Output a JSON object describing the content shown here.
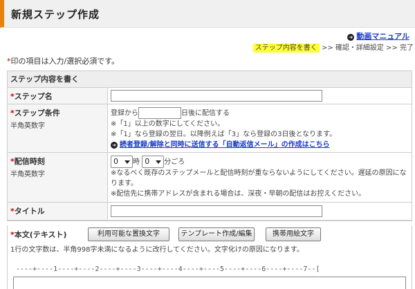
{
  "header": {
    "title": "新規ステップ作成"
  },
  "manual_link": {
    "icon": "circle-arrow-icon",
    "label": "動画マニュアル"
  },
  "steps": {
    "current": "ステップ内容を書く",
    "rest": " >> 確認・詳細設定 >> 完了"
  },
  "required_note": {
    "mark": "*",
    "text": "印の項目は入力/選択必須です。"
  },
  "section": {
    "title": "ステップ内容を書く"
  },
  "fields": {
    "step_name": {
      "mark": "*",
      "label": "ステップ名",
      "value": ""
    },
    "condition": {
      "mark": "*",
      "label": "ステップ条件",
      "sub": "半角英数字",
      "prefix": "登録から",
      "value": "",
      "suffix": "日後に配信する",
      "note1": "※「1」以上の数字にしてください。",
      "note2": "※「1」なら登録の翌日。以降例えば「3」なら登録の3日後となります。",
      "link_icon": "circle-arrow-icon",
      "link": "読者登録/解除と同時に送信する「自動返信メール」の作成はこちら"
    },
    "time": {
      "mark": "*",
      "label": "配信時刻",
      "sub": "半角英数字",
      "hour": "0",
      "hour_unit": "時",
      "minute": "0",
      "minute_unit": "分ごろ",
      "note1": "※なるべく既存のステップメールと配信時刻が重ならないようにしてください。遅延の原因になります。",
      "note2": "※配信先に携帯アドレスが含まれる場合は、深夜・早朝の配信はお控えください。"
    },
    "title": {
      "mark": "*",
      "label": "タイトル",
      "value": ""
    },
    "body": {
      "mark": "*",
      "label": "本文(テキスト)",
      "btn_replace": "利用可能な置換文字",
      "btn_template": "テンプレート作成/編集",
      "btn_emoji": "携帯用絵文字",
      "note": "1行の文字数は、半角998字未満になるように改行してください。文字化けの原因になります。",
      "ruler": "----+----1----+----2----+----3----+----4----+----5----+----6----+----7--[",
      "value": ""
    }
  }
}
